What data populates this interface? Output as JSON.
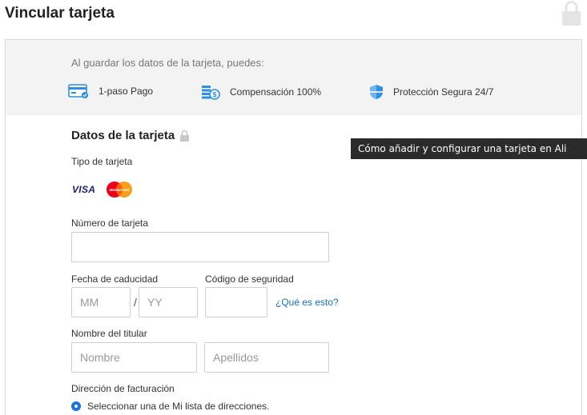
{
  "page": {
    "title": "Vincular tarjeta"
  },
  "benefits": {
    "intro": "Al guardar los datos de la tarjeta, puedes:",
    "items": [
      {
        "label": "1-paso Pago",
        "icon": "card-pay-icon"
      },
      {
        "label": "Compensación 100%",
        "icon": "coins-icon"
      },
      {
        "label": "Protección Segura 24/7",
        "icon": "shield-icon"
      }
    ]
  },
  "card_section": {
    "title": "Datos de la tarjeta",
    "type_label": "Tipo de tarjeta",
    "brands": [
      "VISA",
      "MasterCard"
    ],
    "number_label": "Número de tarjeta",
    "number_value": "",
    "expiry_label": "Fecha de caducidad",
    "month_placeholder": "MM",
    "year_placeholder": "YY",
    "slash": "/",
    "cvv_label": "Código de seguridad",
    "cvv_value": "",
    "cvv_help": "¿Qué es esto?",
    "holder_label": "Nombre del titular",
    "first_name_placeholder": "Nombre",
    "last_name_placeholder": "Apellidos",
    "billing_label": "Dirección de facturación",
    "billing_option": "Seleccionar una de Mi lista de direcciones."
  },
  "tooltip": {
    "text": "Cómo añadir y configurar una tarjeta en Ali"
  },
  "colors": {
    "accent": "#1a73d9",
    "link": "#1a6fc2",
    "tooltip_bg": "#2b2b2b",
    "panel_bg": "#f3f3f3"
  }
}
